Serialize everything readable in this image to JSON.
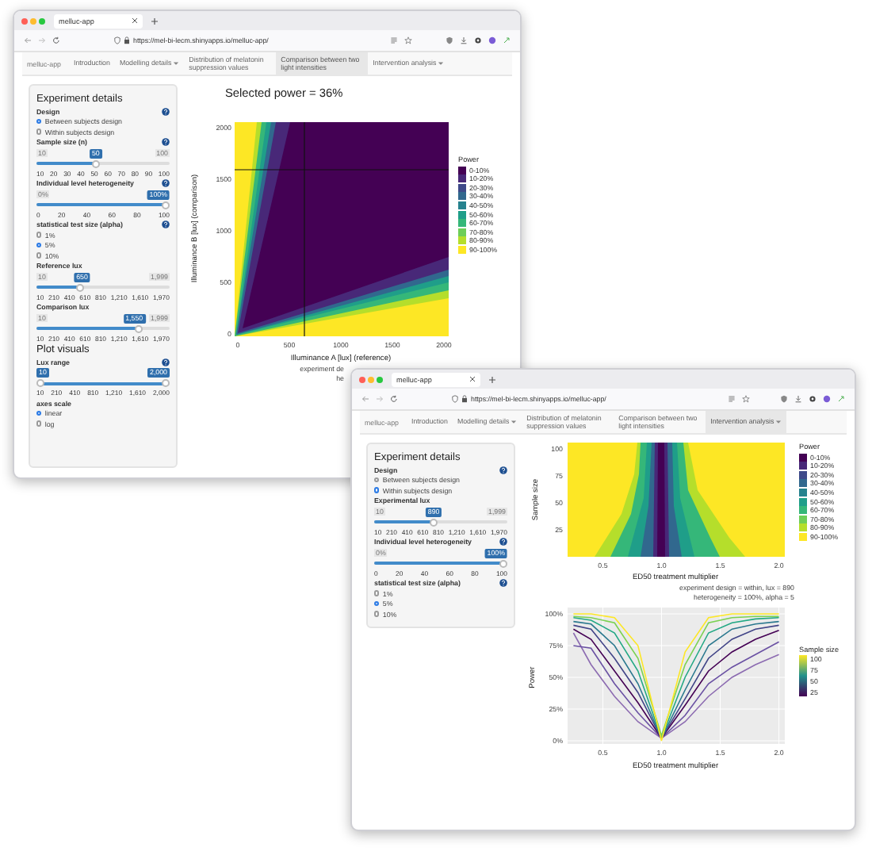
{
  "back_window": {
    "tab_title": "melluc-app",
    "url": "https://mel-bi-lecm.shinyapps.io/melluc-app/",
    "brand": "melluc-app",
    "nav": [
      {
        "label": "Introduction",
        "selected": false,
        "dropdown": false
      },
      {
        "label": "Modelling details",
        "selected": false,
        "dropdown": true
      },
      {
        "label": "Distribution of melatonin suppression values",
        "selected": false,
        "dropdown": false
      },
      {
        "label": "Comparison between two light intensities",
        "selected": true,
        "dropdown": false
      },
      {
        "label": "Intervention analysis",
        "selected": false,
        "dropdown": true
      }
    ],
    "sidebar": [
      {
        "kind": "heading",
        "text": "Experiment details"
      },
      {
        "kind": "label",
        "text": "Design",
        "help": true
      },
      {
        "kind": "radio",
        "text": "Between subjects design",
        "selected": true
      },
      {
        "kind": "radio",
        "text": "Within subjects design",
        "selected": false
      },
      {
        "kind": "label",
        "text": "Sample size (n)",
        "help": true
      },
      {
        "kind": "slider",
        "min": "10",
        "max": "100",
        "value": "50",
        "level": 0.44,
        "ticks": [
          "10",
          "20",
          "30",
          "40",
          "50",
          "60",
          "70",
          "80",
          "90",
          "100"
        ]
      },
      {
        "kind": "label",
        "text": "Individual level heterogeneity",
        "help": true
      },
      {
        "kind": "slider",
        "min": "0%",
        "value": "100%",
        "level": 1,
        "ticks": [
          "0",
          "20",
          "40",
          "60",
          "80",
          "100"
        ]
      },
      {
        "kind": "label",
        "text": "statistical test size (alpha)",
        "help": true
      },
      {
        "kind": "radio",
        "text": "1%",
        "selected": false
      },
      {
        "kind": "radio",
        "text": "5%",
        "selected": true
      },
      {
        "kind": "radio",
        "text": "10%",
        "selected": false
      },
      {
        "kind": "label",
        "text": "Reference lux",
        "help": false
      },
      {
        "kind": "slider",
        "min": "10",
        "max": "1,999",
        "value": "650",
        "level": 0.32,
        "ticks": [
          "10",
          "210",
          "410",
          "610",
          "810",
          "1,210",
          "1,610",
          "1,970"
        ]
      },
      {
        "kind": "label",
        "text": "Comparison lux",
        "help": false
      },
      {
        "kind": "slider",
        "min": "10",
        "max": "1,999",
        "value": "1,550",
        "level": 0.78,
        "ticks": [
          "10",
          "210",
          "410",
          "610",
          "810",
          "1,210",
          "1,610",
          "1,970"
        ]
      },
      {
        "kind": "heading",
        "text": "Plot visuals"
      },
      {
        "kind": "label",
        "text": "Lux range",
        "help": true
      },
      {
        "kind": "range",
        "low": "10",
        "high": "2,000",
        "ticks": [
          "10",
          "210",
          "410",
          "810",
          "1,210",
          "1,610",
          "2,000"
        ]
      },
      {
        "kind": "label",
        "text": "axes scale",
        "help": false
      },
      {
        "kind": "radio",
        "text": "linear",
        "selected": true
      },
      {
        "kind": "radio",
        "text": "log",
        "selected": false
      }
    ],
    "plot": {
      "title": "Selected power = 36%",
      "ylabel": "Illuminance B [lux] (comparison)",
      "xlabel": "Illuminance A [lux] (reference)",
      "yticks": [
        "2000",
        "1500",
        "1000",
        "500",
        "0"
      ],
      "xticks": [
        "0",
        "500",
        "1000",
        "1500",
        "2000"
      ],
      "caption": [
        "experiment de",
        "he"
      ],
      "legend": {
        "title": "Power",
        "items": [
          {
            "label": "0-10%",
            "color": "#440154"
          },
          {
            "label": "10-20%",
            "color": "#482878"
          },
          {
            "label": "20-30%",
            "color": "#3e4989"
          },
          {
            "label": "30-40%",
            "color": "#31688e"
          },
          {
            "label": "40-50%",
            "color": "#26828e"
          },
          {
            "label": "50-60%",
            "color": "#1f9e89"
          },
          {
            "label": "60-70%",
            "color": "#35b779"
          },
          {
            "label": "70-80%",
            "color": "#6ece58"
          },
          {
            "label": "80-90%",
            "color": "#b5de2b"
          },
          {
            "label": "90-100%",
            "color": "#fde725"
          }
        ]
      }
    }
  },
  "front_window": {
    "tab_title": "melluc-app",
    "url": "https://mel-bi-lecm.shinyapps.io/melluc-app/",
    "brand": "melluc-app",
    "nav": [
      {
        "label": "Introduction",
        "selected": false,
        "dropdown": false
      },
      {
        "label": "Modelling details",
        "selected": false,
        "dropdown": true
      },
      {
        "label": "Distribution of melatonin suppression values",
        "selected": false,
        "dropdown": false
      },
      {
        "label": "Comparison between two light intensities",
        "selected": false,
        "dropdown": false
      },
      {
        "label": "Intervention analysis",
        "selected": true,
        "dropdown": true
      }
    ],
    "sidebar": [
      {
        "kind": "heading",
        "text": "Experiment details"
      },
      {
        "kind": "label",
        "text": "Design",
        "help": true
      },
      {
        "kind": "radio",
        "text": "Between subjects design",
        "selected": false
      },
      {
        "kind": "radio",
        "text": "Within subjects design",
        "selected": true
      },
      {
        "kind": "label",
        "text": "Experimental lux",
        "help": false
      },
      {
        "kind": "slider",
        "min": "10",
        "max": "1,999",
        "value": "890",
        "level": 0.44,
        "ticks": [
          "10",
          "210",
          "410",
          "610",
          "810",
          "1,210",
          "1,610",
          "1,970"
        ]
      },
      {
        "kind": "label",
        "text": "Individual level heterogeneity",
        "help": true
      },
      {
        "kind": "slider",
        "min": "0%",
        "value": "100%",
        "level": 1,
        "ticks": [
          "0",
          "20",
          "40",
          "60",
          "80",
          "100"
        ]
      },
      {
        "kind": "label",
        "text": "statistical test size (alpha)",
        "help": true
      },
      {
        "kind": "radio",
        "text": "1%",
        "selected": false
      },
      {
        "kind": "radio",
        "text": "5%",
        "selected": true
      },
      {
        "kind": "radio",
        "text": "10%",
        "selected": false
      }
    ],
    "heatmap": {
      "ylabel": "Sample size",
      "yticks": [
        "100",
        "75",
        "50",
        "25"
      ],
      "xticks": [
        "0.5",
        "1.0",
        "1.5",
        "2.0"
      ],
      "xlabel": "ED50 treatment multiplier",
      "caption": [
        "experiment design = within, lux = 890",
        "heterogeneity = 100%, alpha = 5"
      ],
      "legend": {
        "title": "Power",
        "items": [
          {
            "label": "0-10%",
            "color": "#440154"
          },
          {
            "label": "10-20%",
            "color": "#482878"
          },
          {
            "label": "20-30%",
            "color": "#3e4989"
          },
          {
            "label": "30-40%",
            "color": "#31688e"
          },
          {
            "label": "40-50%",
            "color": "#26828e"
          },
          {
            "label": "50-60%",
            "color": "#1f9e89"
          },
          {
            "label": "60-70%",
            "color": "#35b779"
          },
          {
            "label": "70-80%",
            "color": "#6ece58"
          },
          {
            "label": "80-90%",
            "color": "#b5de2b"
          },
          {
            "label": "90-100%",
            "color": "#fde725"
          }
        ]
      }
    },
    "power_plot": {
      "chart_data": {
        "type": "line",
        "grid": true,
        "xlabel": "ED50 treatment multiplier",
        "ylabel": "Power",
        "x": [
          0.25,
          0.4,
          0.6,
          0.8,
          1.0,
          1.2,
          1.4,
          1.6,
          1.8,
          2.0
        ],
        "xlim": [
          0.2,
          2.05
        ],
        "ylim": [
          0,
          100
        ],
        "xticks": [
          {
            "value": 0.5,
            "label": "0.5"
          },
          {
            "value": 1,
            "label": "1.0"
          },
          {
            "value": 1.5,
            "label": "1.5"
          },
          {
            "value": 2,
            "label": "2.0"
          }
        ],
        "yticks": [
          {
            "value": 0,
            "label": "0%"
          },
          {
            "value": 25,
            "label": "25%"
          },
          {
            "value": 50,
            "label": "50%"
          },
          {
            "value": 75,
            "label": "75%"
          },
          {
            "value": 100,
            "label": "100%"
          }
        ],
        "series": [
          {
            "color": "#8c6bb1",
            "values": [
              85,
              60,
              35,
              15,
              2,
              15,
              35,
              50,
              60,
              68
            ]
          },
          {
            "color": "#6a51a3",
            "values": [
              75,
              73,
              45,
              22,
              2,
              20,
              45,
              58,
              68,
              78
            ]
          },
          {
            "color": "#440154",
            "values": [
              88,
              80,
              55,
              30,
              2,
              28,
              55,
              70,
              80,
              87
            ]
          },
          {
            "color": "#414487",
            "values": [
              91,
              88,
              65,
              38,
              2,
              33,
              65,
              80,
              88,
              91
            ]
          },
          {
            "color": "#2a788e",
            "values": [
              94,
              92,
              75,
              45,
              2,
              40,
              75,
              88,
              92,
              94
            ]
          },
          {
            "color": "#22a884",
            "values": [
              97,
              95,
              85,
              55,
              2,
              50,
              85,
              93,
              96,
              97
            ]
          },
          {
            "color": "#7ad151",
            "values": [
              98,
              97,
              93,
              65,
              4,
              60,
              93,
              97,
              98,
              98
            ]
          },
          {
            "color": "#fde725",
            "values": [
              100,
              100,
              97,
              75,
              0,
              70,
              97,
              100,
              100,
              100
            ]
          }
        ]
      },
      "colorbar": {
        "title": "Sample size",
        "labels": [
          "100",
          "75",
          "50",
          "25"
        ]
      }
    }
  }
}
